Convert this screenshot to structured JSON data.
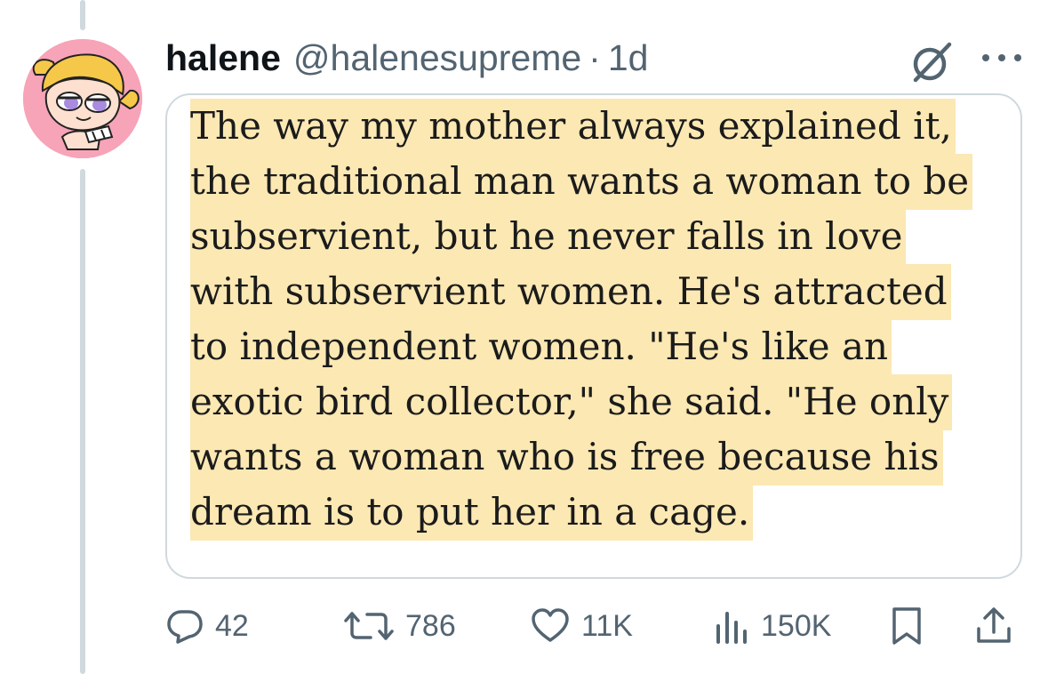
{
  "author": {
    "display_name": "halene",
    "handle": "@halenesupreme",
    "separator": "·",
    "time": "1d"
  },
  "media": {
    "quote_lines": [
      "The way my mother always explained it,",
      "the traditional man wants a woman to be",
      "subservient, but he never falls in love",
      "with subservient women. He's attracted",
      "to independent women. \"He's like an",
      "exotic bird collector,\" she said. \"He only",
      "wants a woman who is free because his",
      "dream is to put her in a cage."
    ],
    "highlight_color": "#fbe8b3"
  },
  "actions": {
    "replies": "42",
    "reposts": "786",
    "likes": "11K",
    "views": "150K"
  },
  "icons": {
    "grok": "grok-icon",
    "more": "more-icon",
    "reply": "reply-icon",
    "repost": "repost-icon",
    "like": "heart-icon",
    "views": "views-icon",
    "bookmark": "bookmark-icon",
    "share": "share-icon"
  },
  "colors": {
    "text_primary": "#0f1419",
    "text_secondary": "#536471",
    "border": "#cfd9de",
    "avatar_bg": "#f7a3b8"
  }
}
